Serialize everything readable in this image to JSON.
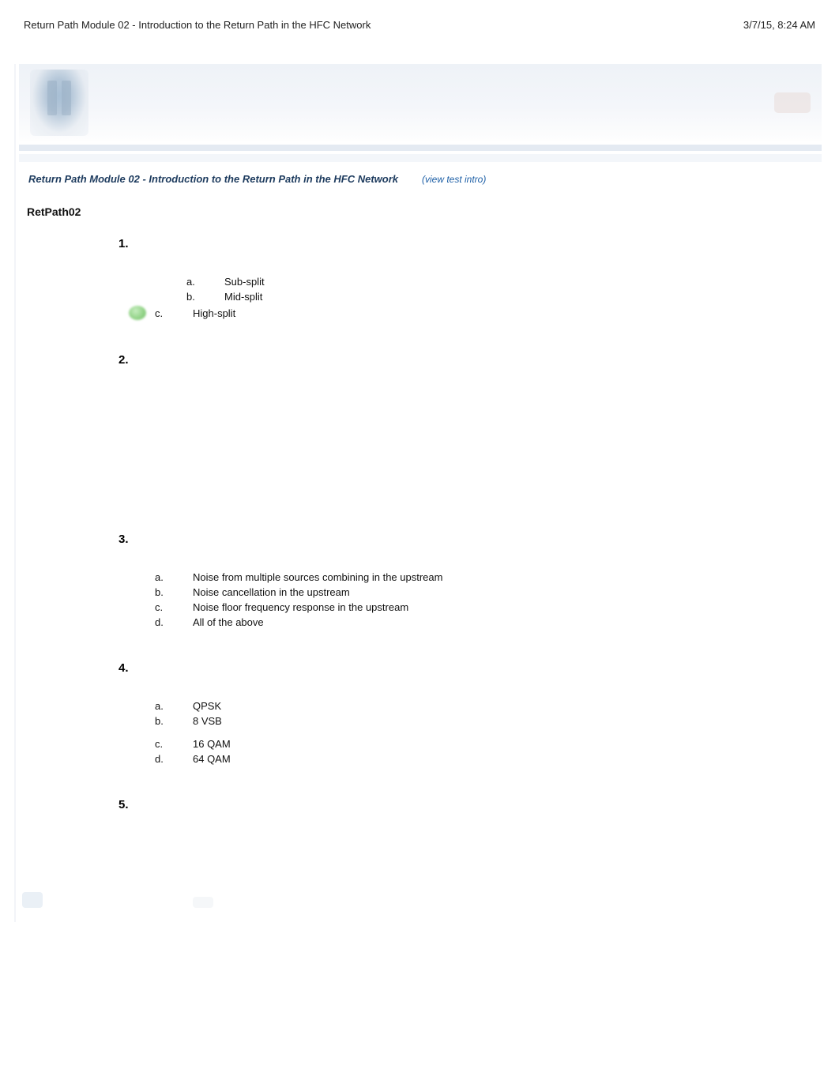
{
  "header": {
    "left": "Return Path Module 02 - Introduction to the Return Path in the HFC Network",
    "right": "3/7/15, 8:24 AM"
  },
  "course": {
    "title": "Return Path Module 02 - Introduction to the Return Path in the HFC Network",
    "view_intro": "(view test intro)",
    "code": "RetPath02"
  },
  "questions": [
    {
      "num": "1.",
      "options": [
        {
          "letter": "a.",
          "text": "Sub-split",
          "correct": false
        },
        {
          "letter": "b.",
          "text": "Mid-split",
          "correct": false
        },
        {
          "letter": "c.",
          "text": "High-split",
          "correct": true
        }
      ]
    },
    {
      "num": "2.",
      "options": []
    },
    {
      "num": "3.",
      "options": [
        {
          "letter": "a.",
          "text": "Noise from multiple sources combining in the upstream",
          "correct": false
        },
        {
          "letter": "b.",
          "text": "Noise cancellation in the upstream",
          "correct": false
        },
        {
          "letter": "c.",
          "text": "Noise floor frequency response in the upstream",
          "correct": false
        },
        {
          "letter": "d.",
          "text": "All of the above",
          "correct": false
        }
      ]
    },
    {
      "num": "4.",
      "options": [
        {
          "letter": "a.",
          "text": "QPSK",
          "correct": false
        },
        {
          "letter": "b.",
          "text": "8 VSB",
          "correct": false
        },
        {
          "letter": "c.",
          "text": "16 QAM",
          "correct": false
        },
        {
          "letter": "d.",
          "text": "64 QAM",
          "correct": false
        }
      ]
    },
    {
      "num": "5.",
      "options": []
    }
  ]
}
